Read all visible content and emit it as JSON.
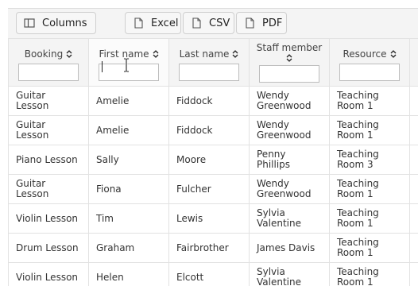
{
  "toolbar": {
    "columns_label": "Columns",
    "excel_label": "Excel",
    "csv_label": "CSV",
    "pdf_label": "PDF"
  },
  "table": {
    "headers": {
      "booking": "Booking",
      "first_name": "First name",
      "last_name": "Last name",
      "staff_member": "Staff member",
      "resource": "Resource"
    },
    "rows": [
      {
        "booking": "Guitar Lesson",
        "first": "Amelie",
        "last": "Fiddock",
        "staff": "Wendy Greenwood",
        "resource": "Teaching Room 1"
      },
      {
        "booking": "Guitar Lesson",
        "first": "Amelie",
        "last": "Fiddock",
        "staff": "Wendy Greenwood",
        "resource": "Teaching Room 1"
      },
      {
        "booking": "Piano Lesson",
        "first": "Sally",
        "last": "Moore",
        "staff": "Penny Phillips",
        "resource": "Teaching Room 3"
      },
      {
        "booking": "Guitar Lesson",
        "first": "Fiona",
        "last": "Fulcher",
        "staff": "Wendy Greenwood",
        "resource": "Teaching Room 1"
      },
      {
        "booking": "Violin Lesson",
        "first": "Tim",
        "last": "Lewis",
        "staff": "Sylvia Valentine",
        "resource": "Teaching Room 1"
      },
      {
        "booking": "Drum Lesson",
        "first": "Graham",
        "last": "Fairbrother",
        "staff": "James Davis",
        "resource": "Teaching Room 1"
      },
      {
        "booking": "Violin Lesson",
        "first": "Helen",
        "last": "Elcott",
        "staff": "Sylvia Valentine",
        "resource": "Teaching Room 1"
      }
    ]
  },
  "icons": {
    "columns": "columns-icon",
    "excel": "file-icon",
    "csv": "file-icon",
    "pdf": "file-icon",
    "sort": "sort-icon",
    "cursor": "text-cursor-icon"
  }
}
